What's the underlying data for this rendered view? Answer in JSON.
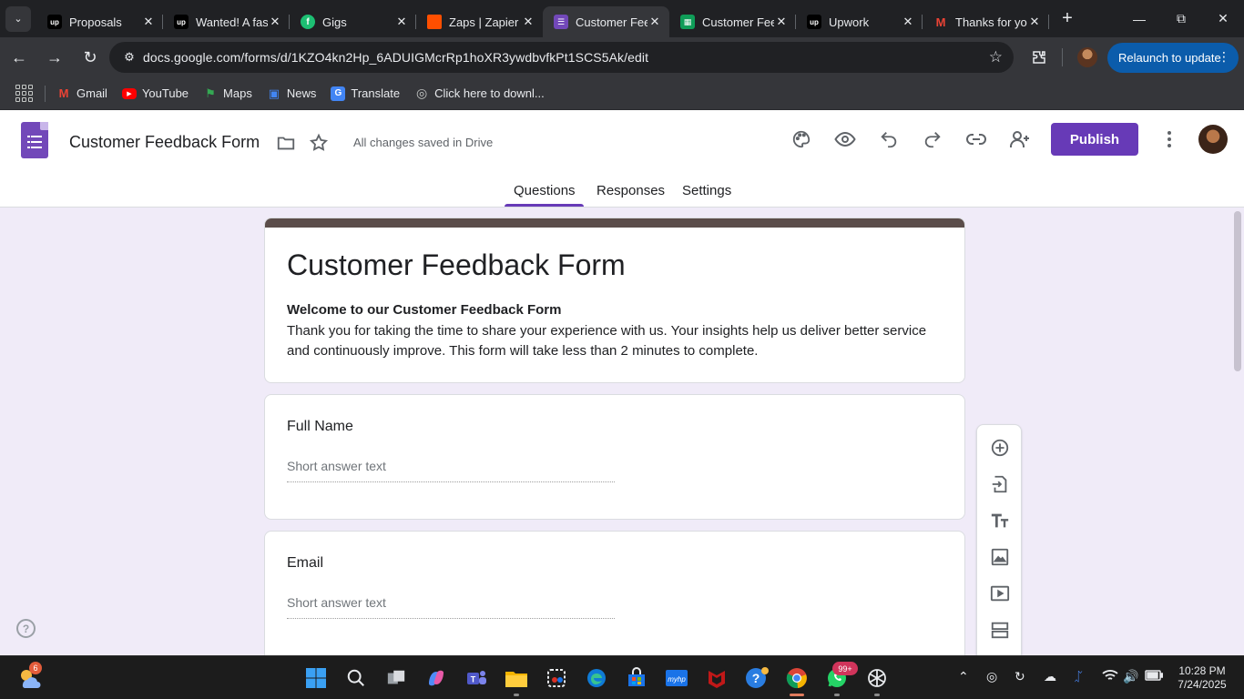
{
  "browser": {
    "tabs": [
      {
        "title": "Proposals",
        "icon": "upwork-icon"
      },
      {
        "title": "Wanted! A fast-paced",
        "icon": "upwork-icon"
      },
      {
        "title": "Gigs",
        "icon": "fiverr-icon"
      },
      {
        "title": "Zaps | Zapier",
        "icon": "zapier-icon"
      },
      {
        "title": "Customer Feedback Form",
        "icon": "google-forms-icon",
        "active": true
      },
      {
        "title": "Customer Feedback Form (Responses)",
        "icon": "google-sheets-icon"
      },
      {
        "title": "Upwork",
        "icon": "upwork-icon"
      },
      {
        "title": "Thanks for your order",
        "icon": "gmail-icon"
      }
    ],
    "url": "docs.google.com/forms/d/1KZO4kn2Hp_6ADUIGMcrRp1hoXR3ywdbvfkPt1SCS5Ak/edit",
    "relaunch_label": "Relaunch to update",
    "bookmarks": [
      {
        "label": "Gmail",
        "icon": "gmail-icon"
      },
      {
        "label": "YouTube",
        "icon": "youtube-icon"
      },
      {
        "label": "Maps",
        "icon": "maps-icon"
      },
      {
        "label": "News",
        "icon": "news-icon"
      },
      {
        "label": "Translate",
        "icon": "translate-icon"
      },
      {
        "label": "Click here to downl...",
        "icon": "globe-icon"
      }
    ]
  },
  "forms": {
    "doc_title": "Customer Feedback Form",
    "save_status": "All changes saved in Drive",
    "publish_label": "Publish",
    "tabs": [
      "Questions",
      "Responses",
      "Settings"
    ],
    "active_tab": "Questions",
    "accent_color": "#673ab7",
    "header_stripe_color": "#5b4d4a",
    "form": {
      "title": "Customer Feedback Form",
      "description_heading": "Welcome to our Customer Feedback Form",
      "description_body": "Thank you for taking the time to share your experience with us. Your insights help us deliver better service and continuously improve. This form will take less than 2 minutes to complete."
    },
    "questions": [
      {
        "label": "Full Name",
        "placeholder": "Short answer text"
      },
      {
        "label": "Email",
        "placeholder": "Short answer text"
      }
    ],
    "side_tools": [
      "add-question-icon",
      "import-questions-icon",
      "add-title-icon",
      "add-image-icon",
      "add-video-icon",
      "add-section-icon"
    ]
  },
  "taskbar": {
    "weather_badge": "6",
    "whatsapp_badge": "99+",
    "time": "10:28 PM",
    "date": "7/24/2025"
  }
}
